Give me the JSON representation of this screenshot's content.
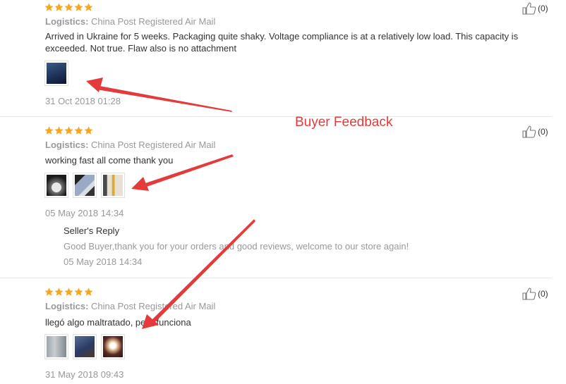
{
  "reviews": [
    {
      "logistics_label": "Logistics:",
      "logistics_value": "China Post Registered Air Mail",
      "text": "Arrived in Ukraine for 5 weeks. Packaging quite shaky. Voltage compliance is at a relatively low load. This capacity is exceeded. Not true. Flaw also is no attachment",
      "date": "31 Oct 2018 01:28",
      "likes": "(0)",
      "rating": 5
    },
    {
      "logistics_label": "Logistics:",
      "logistics_value": "China Post Registered Air Mail",
      "text": "working fast all come thank you",
      "date": "05 May 2018 14:34",
      "likes": "(0)",
      "rating": 5,
      "reply": {
        "title": "Seller's Reply",
        "text": "Good Buyer,thank you for your orders and good reviews, welcome to our store again!",
        "date": "05 May 2018 14:34"
      }
    },
    {
      "logistics_label": "Logistics:",
      "logistics_value": "China Post Registered Air Mail",
      "text": "llegó algo maltratado, pero funciona",
      "date": "31 May 2018 09:43",
      "likes": "(0)",
      "rating": 5
    }
  ],
  "annotation": "Buyer Feedback",
  "colors": {
    "star": "#f5a623",
    "arrow": "#e53a3a"
  }
}
